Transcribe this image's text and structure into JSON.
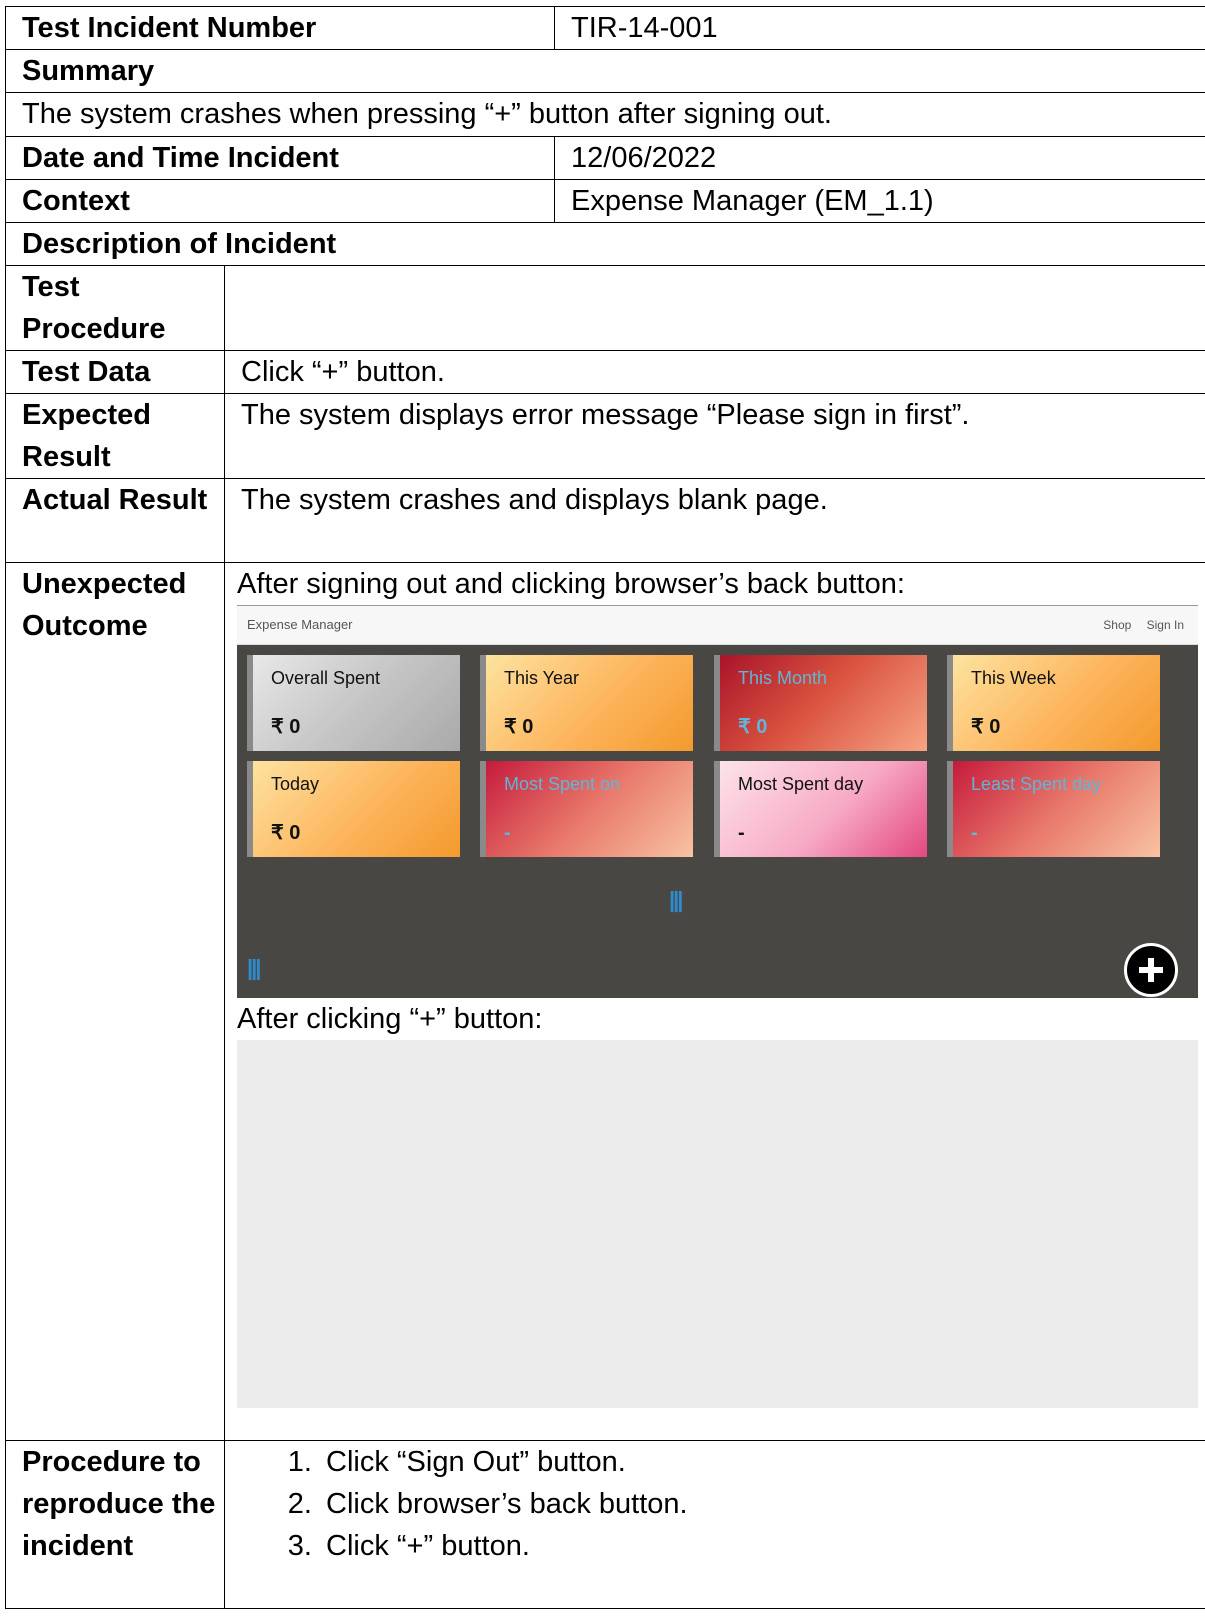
{
  "rows": {
    "test_incident_number_label": "Test Incident Number",
    "test_incident_number_value": "TIR-14-001",
    "summary_label": "Summary",
    "summary_text": "The system crashes when pressing “+” button after signing out.",
    "date_label": "Date and Time Incident",
    "date_value": "12/06/2022",
    "context_label": "Context",
    "context_value": "Expense Manager (EM_1.1)",
    "description_label": "Description of Incident",
    "test_procedure_label": "Test Procedure",
    "test_procedure_value": "",
    "test_data_label": "Test Data",
    "test_data_value": "Click “+” button.",
    "expected_label": "Expected Result",
    "expected_value": "The system displays error message “Please sign in first”.",
    "actual_label": "Actual Result",
    "actual_value": "The system crashes and displays blank page.",
    "unexpected_label": "Unexpected Outcome",
    "unexpected_caption1": "After signing out and clicking browser’s back button:",
    "unexpected_caption2": "After clicking “+” button:",
    "procedure_label": "Procedure to reproduce the incident",
    "procedure_steps": [
      "Click “Sign Out” button.",
      "Click browser’s back button.",
      "Click “+” button."
    ]
  },
  "screenshot": {
    "brand": "Expense Manager",
    "nav_shop": "Shop",
    "nav_signin": "Sign In",
    "cards": [
      {
        "title": "Overall Spent",
        "value": "₹ 0"
      },
      {
        "title": "This Year",
        "value": "₹ 0"
      },
      {
        "title": "This Month",
        "value": "₹ 0"
      },
      {
        "title": "This Week",
        "value": "₹ 0"
      },
      {
        "title": "Today",
        "value": "₹ 0"
      },
      {
        "title": "Most Spent on",
        "value": "-"
      },
      {
        "title": "Most Spent day",
        "value": "-"
      },
      {
        "title": "Least Spent day",
        "value": "-"
      }
    ],
    "add_icon": "plus-circle-icon",
    "chart_icon": "bar-chart-icon"
  }
}
